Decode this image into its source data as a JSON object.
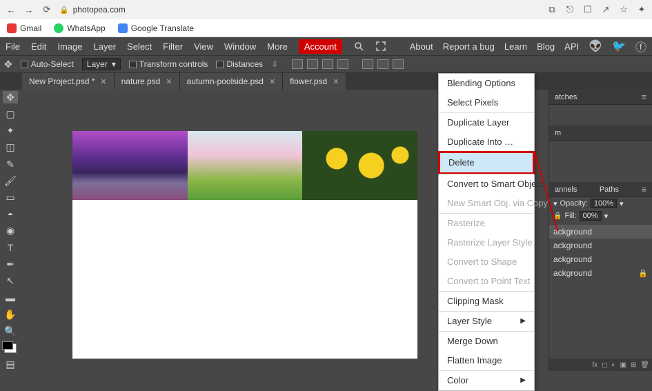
{
  "browser": {
    "url": "photopea.com",
    "bookmarks": [
      "Gmail",
      "WhatsApp",
      "Google Translate"
    ]
  },
  "menubar": {
    "items": [
      "File",
      "Edit",
      "Image",
      "Layer",
      "Select",
      "Filter",
      "View",
      "Window",
      "More"
    ],
    "right": [
      "About",
      "Report a bug",
      "Learn",
      "Blog",
      "API"
    ],
    "account": "Account"
  },
  "optionsbar": {
    "auto_select": "Auto-Select",
    "scope": "Layer",
    "transform": "Transform controls",
    "distances": "Distances"
  },
  "tabs": [
    {
      "label": "New Project.psd *"
    },
    {
      "label": "nature.psd"
    },
    {
      "label": "autumn-poolside.psd"
    },
    {
      "label": "flower.psd"
    }
  ],
  "context_menu": {
    "items": [
      {
        "label": "Blending Options",
        "enabled": true
      },
      {
        "label": "Select Pixels",
        "enabled": true,
        "sep": false
      },
      {
        "label": "Duplicate Layer",
        "enabled": true,
        "sep": true
      },
      {
        "label": "Duplicate Into …",
        "enabled": true
      },
      {
        "label": "Delete",
        "enabled": true,
        "highlight": true
      },
      {
        "label": "Convert to Smart Object",
        "enabled": true,
        "sep": true
      },
      {
        "label": "New Smart Obj. via Copy",
        "enabled": false
      },
      {
        "label": "Rasterize",
        "enabled": false,
        "sep": true
      },
      {
        "label": "Rasterize Layer Style",
        "enabled": false
      },
      {
        "label": "Convert to Shape",
        "enabled": false
      },
      {
        "label": "Convert to Point Text",
        "enabled": false
      },
      {
        "label": "Clipping Mask",
        "enabled": true,
        "sep": true
      },
      {
        "label": "Layer Style",
        "enabled": true,
        "sub": true,
        "sep": true
      },
      {
        "label": "Merge Down",
        "enabled": true,
        "sep": true
      },
      {
        "label": "Flatten Image",
        "enabled": true
      },
      {
        "label": "Color",
        "enabled": true,
        "sub": true,
        "sep": true
      }
    ]
  },
  "panels": {
    "swatches_tab": "atches",
    "histogram_tab": "m",
    "channels_tab": "annels",
    "paths_tab": "Paths",
    "opacity_label": "Opacity:",
    "opacity_value": "100%",
    "fill_label": "Fill:",
    "fill_value": "00%",
    "layers": [
      {
        "name": "ackground",
        "selected": true
      },
      {
        "name": "ackground"
      },
      {
        "name": "ackground"
      },
      {
        "name": "ackground",
        "locked": true
      }
    ]
  }
}
